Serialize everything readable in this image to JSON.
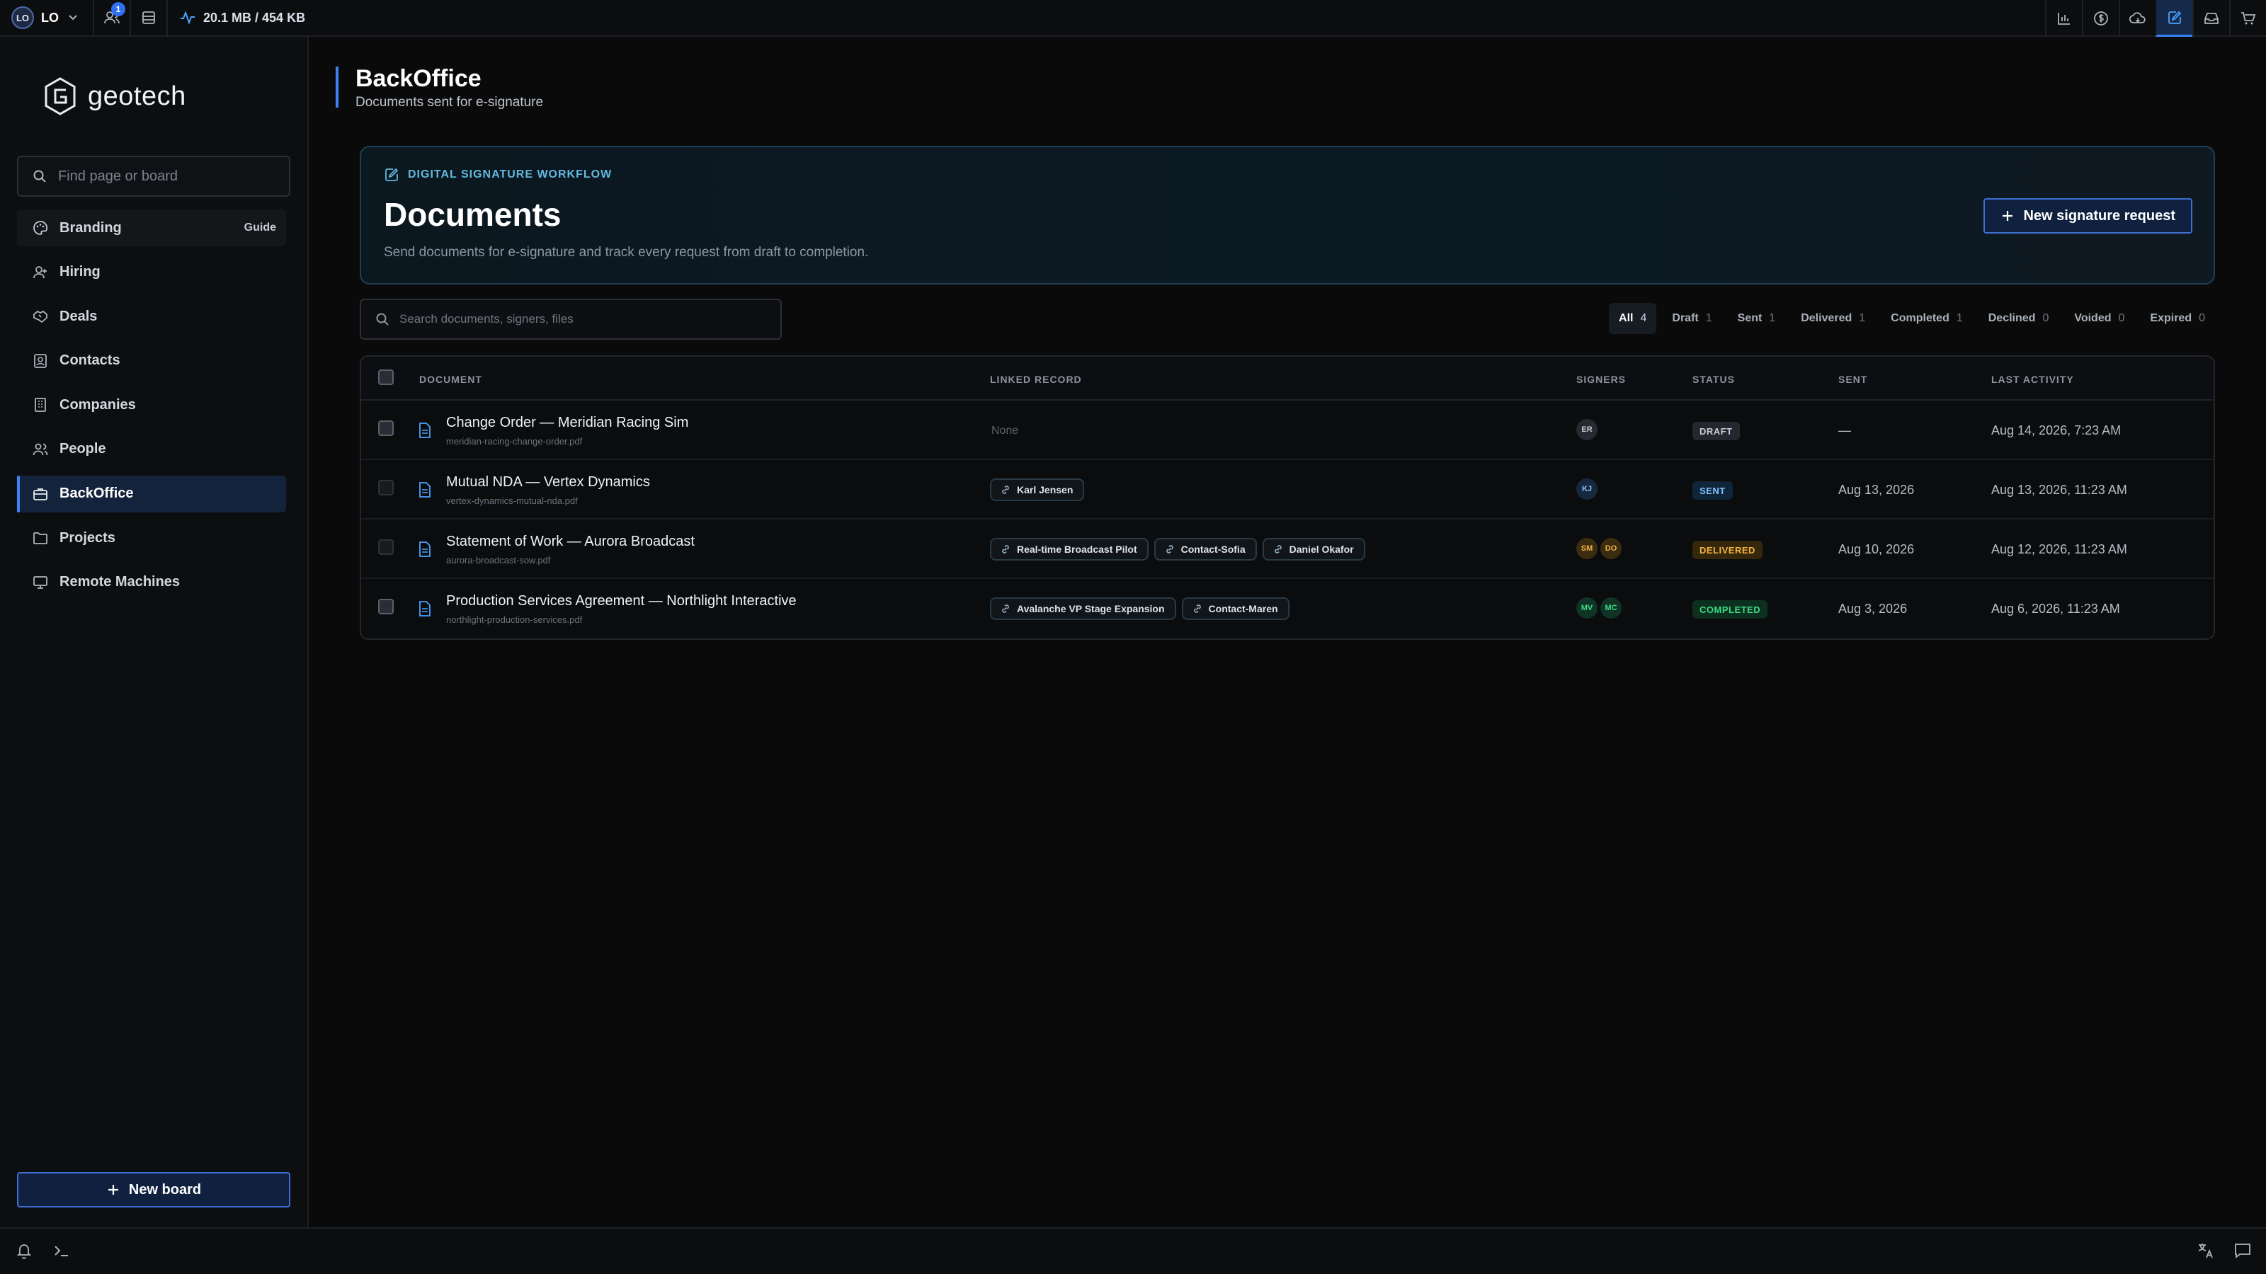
{
  "topbar": {
    "workspace_initials": "LO",
    "workspace_name": "LO",
    "notifications_count": "1",
    "memory": "20.1 MB / 454 KB"
  },
  "sidebar": {
    "brand": "geotech",
    "search_placeholder": "Find page or board",
    "branding_label": "Branding",
    "guide_label": "Guide",
    "items": [
      {
        "label": "Hiring"
      },
      {
        "label": "Deals"
      },
      {
        "label": "Contacts"
      },
      {
        "label": "Companies"
      },
      {
        "label": "People"
      },
      {
        "label": "BackOffice"
      },
      {
        "label": "Projects"
      },
      {
        "label": "Remote Machines"
      }
    ],
    "new_board_label": "New board"
  },
  "page": {
    "title": "BackOffice",
    "subtitle": "Documents sent for e-signature"
  },
  "hero": {
    "kicker": "DIGITAL SIGNATURE WORKFLOW",
    "title": "Documents",
    "description": "Send documents for e-signature and track every request from draft to completion.",
    "button_label": "New signature request"
  },
  "doc_search": {
    "placeholder": "Search documents, signers, files"
  },
  "filters": [
    {
      "label": "All",
      "count": "4"
    },
    {
      "label": "Draft",
      "count": "1"
    },
    {
      "label": "Sent",
      "count": "1"
    },
    {
      "label": "Delivered",
      "count": "1"
    },
    {
      "label": "Completed",
      "count": "1"
    },
    {
      "label": "Declined",
      "count": "0"
    },
    {
      "label": "Voided",
      "count": "0"
    },
    {
      "label": "Expired",
      "count": "0"
    }
  ],
  "table": {
    "headers": {
      "document": "DOCUMENT",
      "linked": "LINKED RECORD",
      "signers": "SIGNERS",
      "status": "STATUS",
      "sent": "SENT",
      "activity": "LAST ACTIVITY"
    },
    "rows": [
      {
        "title": "Change Order — Meridian Racing Sim",
        "file": "meridian-racing-change-order.pdf",
        "linked_none": "None",
        "linked": [],
        "signers": [
          "ER"
        ],
        "status": "DRAFT",
        "sent": "—",
        "activity": "Aug 14, 2026, 7:23 AM"
      },
      {
        "title": "Mutual NDA — Vertex Dynamics",
        "file": "vertex-dynamics-mutual-nda.pdf",
        "linked": [
          "Karl Jensen"
        ],
        "signers": [
          "KJ"
        ],
        "status": "SENT",
        "sent": "Aug 13, 2026",
        "activity": "Aug 13, 2026, 11:23 AM"
      },
      {
        "title": "Statement of Work — Aurora Broadcast",
        "file": "aurora-broadcast-sow.pdf",
        "linked": [
          "Real-time Broadcast Pilot",
          "Contact-Sofia",
          "Daniel Okafor"
        ],
        "signers": [
          "SM",
          "DO"
        ],
        "status": "DELIVERED",
        "sent": "Aug 10, 2026",
        "activity": "Aug 12, 2026, 11:23 AM"
      },
      {
        "title": "Production Services Agreement — Northlight Interactive",
        "file": "northlight-production-services.pdf",
        "linked": [
          "Avalanche VP Stage Expansion",
          "Contact-Maren"
        ],
        "signers": [
          "MV",
          "MC"
        ],
        "status": "COMPLETED",
        "sent": "Aug 3, 2026",
        "activity": "Aug 6, 2026, 11:23 AM"
      }
    ]
  },
  "colors": {
    "accent": "#3b82f6",
    "draft": "#9aa1ab",
    "sent": "#7cc4ff",
    "delivered": "#f2b441",
    "completed": "#3ddc84"
  }
}
